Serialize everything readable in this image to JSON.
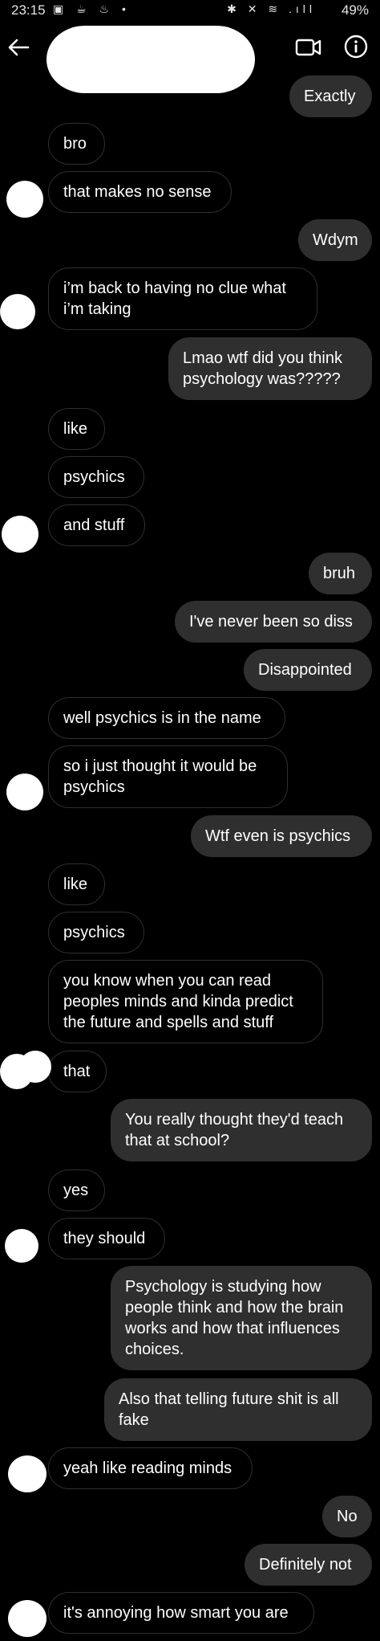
{
  "status_bar": {
    "time": "23:15",
    "left_icons": "▣ ☕ ♨ •",
    "right_icons": "✱ ✕ ≋ .ıll",
    "battery": "49%"
  },
  "header": {
    "contact_name": "",
    "back_icon": "arrow-left",
    "video_icon": "video-camera",
    "info_icon": "info-circle"
  },
  "messages": [
    {
      "side": "sent",
      "text": "Exactly"
    },
    {
      "side": "recv",
      "text": "bro"
    },
    {
      "side": "recv",
      "text": "that makes no sense"
    },
    {
      "side": "sent",
      "text": "Wdym"
    },
    {
      "side": "recv",
      "text": "i’m back to having no clue what i’m taking"
    },
    {
      "side": "sent",
      "text": "Lmao wtf did you think psychology was?????"
    },
    {
      "side": "recv",
      "text": "like"
    },
    {
      "side": "recv",
      "text": "psychics"
    },
    {
      "side": "recv",
      "text": "and stuff"
    },
    {
      "side": "sent",
      "text": "bruh"
    },
    {
      "side": "sent",
      "text": "I've never been so diss"
    },
    {
      "side": "sent",
      "text": "Disappointed"
    },
    {
      "side": "recv",
      "text": "well psychics is in the name"
    },
    {
      "side": "recv",
      "text": "so i just thought it would be psychics"
    },
    {
      "side": "sent",
      "text": "Wtf even is psychics"
    },
    {
      "side": "recv",
      "text": "like"
    },
    {
      "side": "recv",
      "text": "psychics"
    },
    {
      "side": "recv",
      "text": "you know when you can read peoples minds and kinda predict the future and spells and stuff"
    },
    {
      "side": "recv",
      "text": "that"
    },
    {
      "side": "sent",
      "text": "You really thought they'd teach that at school?"
    },
    {
      "side": "recv",
      "text": "yes"
    },
    {
      "side": "recv",
      "text": "they should"
    },
    {
      "side": "sent",
      "text": "Psychology is studying how people think and how the brain works and how that influences choices."
    },
    {
      "side": "sent",
      "text": "Also that telling future shit is all fake"
    },
    {
      "side": "recv",
      "text": "yeah like reading minds"
    },
    {
      "side": "sent",
      "text": "No"
    },
    {
      "side": "sent",
      "text": "Definitely not"
    },
    {
      "side": "recv",
      "text": "it's annoying how smart you are"
    }
  ],
  "colors": {
    "background": "#000000",
    "sent_bubble": "#2f2f2f",
    "recv_border": "#2f2f2f",
    "text": "#ffffff"
  }
}
